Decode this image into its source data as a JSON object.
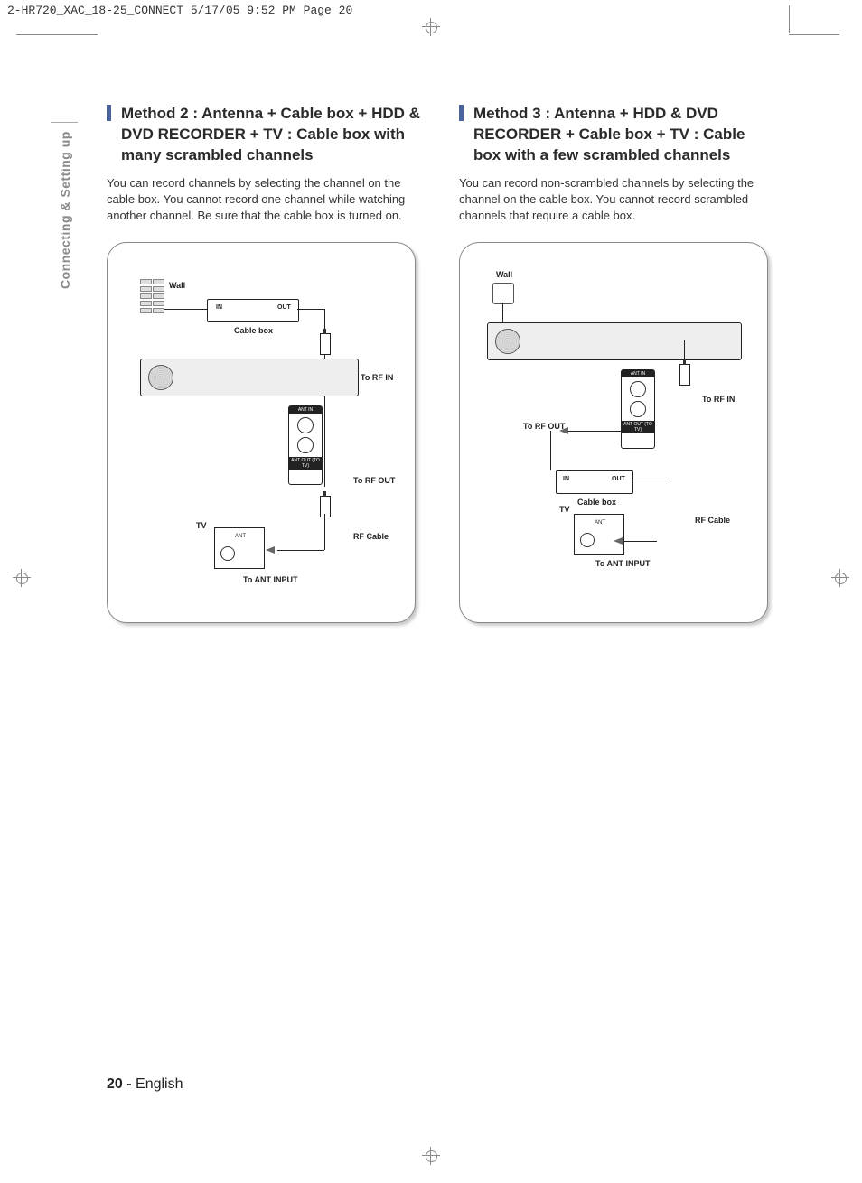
{
  "print_header": "2-HR720_XAC_18-25_CONNECT  5/17/05  9:52 PM  Page 20",
  "side_tab": "Connecting & Setting up",
  "method2": {
    "title": "Method 2 : Antenna + Cable box + HDD & DVD RECORDER + TV : Cable box with many scrambled channels",
    "body": "You can record channels by selecting the channel on the cable box. You cannot record one channel while watching another channel. Be sure that the cable box is turned on.",
    "labels": {
      "wall": "Wall",
      "cable_box": "Cable box",
      "in": "IN",
      "out": "OUT",
      "to_rf_in": "To RF IN",
      "to_rf_out": "To RF OUT",
      "rf_cable": "RF Cable",
      "tv": "TV",
      "ant": "ANT",
      "to_ant_input": "To ANT INPUT",
      "ant_in": "ANT IN",
      "ant_out": "ANT OUT (TO TV)"
    }
  },
  "method3": {
    "title": "Method 3 : Antenna + HDD & DVD RECORDER + Cable box + TV : Cable box with a few scrambled channels",
    "body": "You can record non-scrambled channels by selecting the channel on the cable box. You cannot record scrambled channels that require a cable box.",
    "labels": {
      "wall": "Wall",
      "cable_box": "Cable box",
      "in": "IN",
      "out": "OUT",
      "to_rf_in": "To RF IN",
      "to_rf_out": "To RF OUT",
      "rf_cable": "RF Cable",
      "tv": "TV",
      "ant": "ANT",
      "to_ant_input": "To ANT INPUT",
      "ant_in": "ANT IN",
      "ant_out": "ANT OUT (TO TV)"
    }
  },
  "footer": {
    "page": "20 -",
    "lang": "English"
  }
}
